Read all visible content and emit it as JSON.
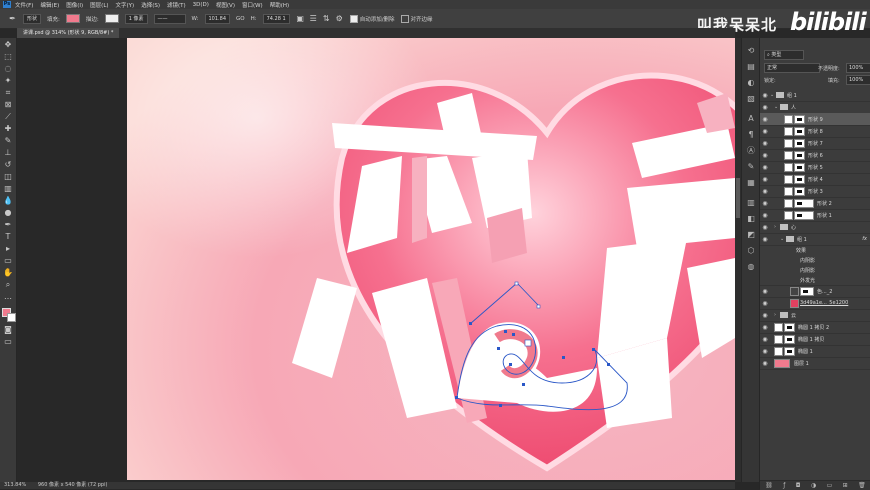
{
  "menu": [
    "文件(F)",
    "编辑(E)",
    "图像(I)",
    "图层(L)",
    "文字(Y)",
    "选择(S)",
    "滤镜(T)",
    "3D(D)",
    "视图(V)",
    "窗口(W)",
    "帮助(H)"
  ],
  "app_logo": "Ps",
  "options": {
    "mode": "形状",
    "fill_label": "填充:",
    "stroke_label": "描边:",
    "stroke_width": "1 像素",
    "w_label": "W:",
    "w_value": "101.84",
    "go_label": "GO",
    "h_label": "H:",
    "h_value": "74.28 1",
    "auto_add": "自动添加/删除",
    "align_edges": "对齐边缘",
    "fill_color": "#f07a8d"
  },
  "watermark": "叫我呆呆北",
  "bilibili": "bilibili",
  "document_tab": "讲课.psd @ 314% (形状 9, RGB/8#) *",
  "status": {
    "zoom": "313.84%",
    "doc": "960 像素 x 540 像素 (72 ppi)"
  },
  "layers_panel": {
    "filter_kind": "类型",
    "blend_mode": "正常",
    "opacity_label": "不透明度:",
    "opacity": "100%",
    "lock_label": "锁定:",
    "fill_label": "填充:",
    "fill": "100%",
    "rows": [
      {
        "name": "组 1",
        "type": "group"
      },
      {
        "name": "人",
        "type": "group"
      },
      {
        "name": "形状 9",
        "type": "shape",
        "selected": true
      },
      {
        "name": "形状 8",
        "type": "shape"
      },
      {
        "name": "形状 7",
        "type": "shape"
      },
      {
        "name": "形状 6",
        "type": "shape"
      },
      {
        "name": "形状 5",
        "type": "shape"
      },
      {
        "name": "形状 4",
        "type": "shape"
      },
      {
        "name": "形状 3",
        "type": "shape"
      },
      {
        "name": "形状 2",
        "type": "shape"
      },
      {
        "name": "形状 1",
        "type": "shape"
      },
      {
        "name": "心",
        "type": "group"
      },
      {
        "name": "组 1",
        "type": "group"
      },
      {
        "name": "效果",
        "type": "fx"
      },
      {
        "name": "内阴影",
        "type": "effect"
      },
      {
        "name": "内阴影",
        "type": "effect"
      },
      {
        "name": "外发光",
        "type": "effect"
      },
      {
        "name": "色..._2",
        "type": "adjust"
      },
      {
        "name": "3d49a1e..._5e1200",
        "type": "image"
      },
      {
        "name": "云",
        "type": "group"
      },
      {
        "name": "椭圆 1 拷贝 2",
        "type": "shape"
      },
      {
        "name": "椭圆 1 拷贝",
        "type": "shape"
      },
      {
        "name": "椭圆 1",
        "type": "shape"
      },
      {
        "name": "图层 1",
        "type": "shape"
      }
    ]
  },
  "canvas_text": "恋爱",
  "colors": {
    "accent": "#f07a8d",
    "heart": "#f04b6c",
    "bg_pink": "#f7a3b4",
    "path": "#2a57c7"
  }
}
